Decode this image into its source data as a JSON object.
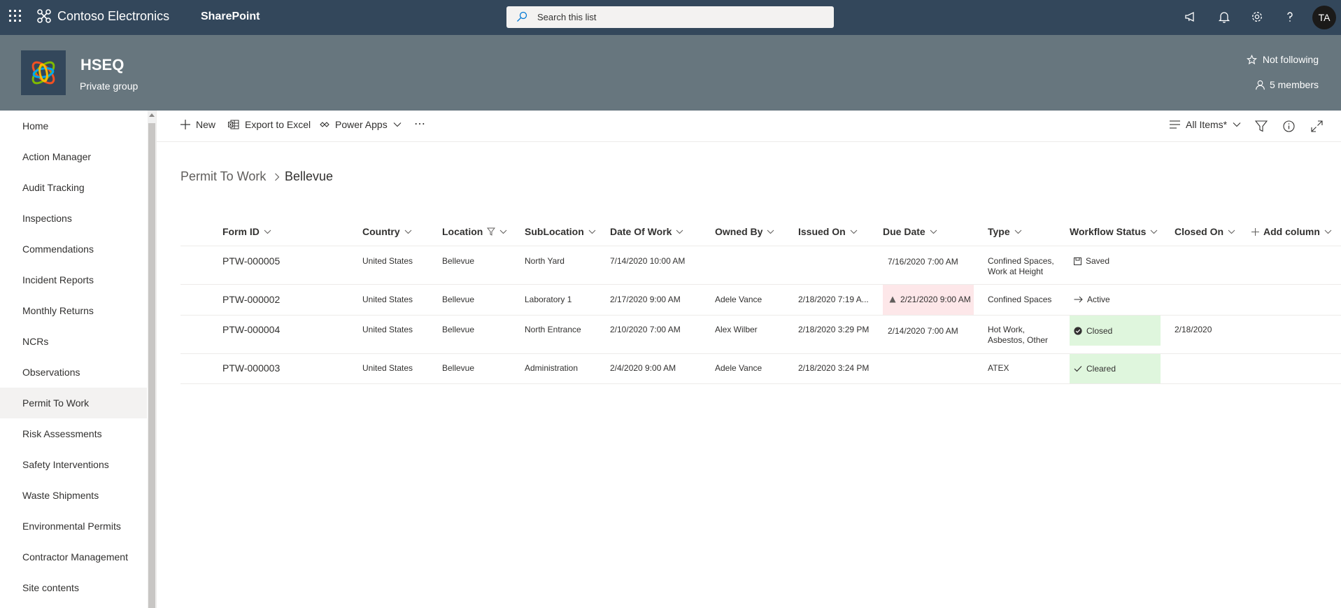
{
  "suite": {
    "brand": "Contoso Electronics",
    "app": "SharePoint",
    "search_placeholder": "Search this list",
    "avatar": "TA"
  },
  "site": {
    "title": "HSEQ",
    "subtitle": "Private group",
    "follow_label": "Not following",
    "members_label": "5 members"
  },
  "nav": {
    "items": [
      {
        "label": "Home"
      },
      {
        "label": "Action Manager"
      },
      {
        "label": "Audit Tracking"
      },
      {
        "label": "Inspections"
      },
      {
        "label": "Commendations"
      },
      {
        "label": "Incident Reports"
      },
      {
        "label": "Monthly Returns"
      },
      {
        "label": "NCRs"
      },
      {
        "label": "Observations"
      },
      {
        "label": "Permit To Work"
      },
      {
        "label": "Risk Assessments"
      },
      {
        "label": "Safety Interventions"
      },
      {
        "label": "Waste Shipments"
      },
      {
        "label": "Environmental Permits"
      },
      {
        "label": "Contractor Management"
      },
      {
        "label": "Site contents"
      }
    ],
    "selected": "Permit To Work"
  },
  "commands": {
    "new": "New",
    "export": "Export to Excel",
    "powerapps": "Power Apps",
    "more": "⋯",
    "view": "All Items*"
  },
  "breadcrumb": {
    "parent": "Permit To Work",
    "current": "Bellevue"
  },
  "table": {
    "headers": {
      "form_id": "Form ID",
      "country": "Country",
      "location": "Location",
      "sublocation": "SubLocation",
      "date_of_work": "Date Of Work",
      "owned_by": "Owned By",
      "issued_on": "Issued On",
      "due_date": "Due Date",
      "type": "Type",
      "workflow_status": "Workflow Status",
      "closed_on": "Closed On",
      "add_column": "Add column"
    },
    "rows": [
      {
        "form_id": "PTW-000005",
        "country": "United States",
        "location": "Bellevue",
        "sublocation": "North Yard",
        "date_of_work": "7/14/2020 10:00 AM",
        "owned_by": "",
        "issued_on": "",
        "due_date": "7/16/2020 7:00 AM",
        "due_overdue": false,
        "type_line1": "Confined Spaces,",
        "type_line2": "Work at Height",
        "status": "Saved",
        "status_icon": "save-icon",
        "closed_on": ""
      },
      {
        "form_id": "PTW-000002",
        "country": "United States",
        "location": "Bellevue",
        "sublocation": "Laboratory 1",
        "date_of_work": "2/17/2020 9:00 AM",
        "owned_by": "Adele Vance",
        "issued_on": "2/18/2020 7:19 A...",
        "due_date": "2/21/2020 9:00 AM",
        "due_overdue": true,
        "type_line1": "Confined Spaces",
        "type_line2": "",
        "status": "Active",
        "status_icon": "arrow-right-icon",
        "closed_on": ""
      },
      {
        "form_id": "PTW-000004",
        "country": "United States",
        "location": "Bellevue",
        "sublocation": "North Entrance",
        "date_of_work": "2/10/2020 7:00 AM",
        "owned_by": "Alex Wilber",
        "issued_on": "2/18/2020 3:29 PM",
        "due_date": "2/14/2020 7:00 AM",
        "due_overdue": false,
        "type_line1": "Hot Work,",
        "type_line2": "Asbestos, Other",
        "status": "Closed",
        "status_icon": "check-circle-icon",
        "closed_on": "2/18/2020"
      },
      {
        "form_id": "PTW-000003",
        "country": "United States",
        "location": "Bellevue",
        "sublocation": "Administration",
        "date_of_work": "2/4/2020 9:00 AM",
        "owned_by": "Adele Vance",
        "issued_on": "2/18/2020 3:24 PM",
        "due_date": "",
        "due_overdue": false,
        "type_line1": "ATEX",
        "type_line2": "",
        "status": "Cleared",
        "status_icon": "checkmark-icon",
        "closed_on": ""
      }
    ]
  },
  "colors": {
    "suitebar": "#33475b",
    "siteheader": "#67767e",
    "overdue_bg": "#fde7e9",
    "closed_bg": "#dff6dd"
  }
}
